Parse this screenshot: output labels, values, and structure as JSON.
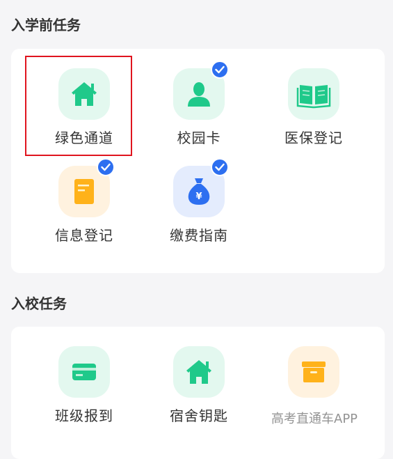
{
  "sections": [
    {
      "title": "入学前任务",
      "items": [
        {
          "label": "绿色通道",
          "icon": "house-icon",
          "checked": false
        },
        {
          "label": "校园卡",
          "icon": "person-icon",
          "checked": true
        },
        {
          "label": "医保登记",
          "icon": "book-icon",
          "checked": false
        },
        {
          "label": "信息登记",
          "icon": "document-icon",
          "checked": true
        },
        {
          "label": "缴费指南",
          "icon": "money-bag-icon",
          "checked": true
        }
      ]
    },
    {
      "title": "入校任务",
      "items": [
        {
          "label": "班级报到",
          "icon": "card-icon",
          "checked": false
        },
        {
          "label": "宿舍钥匙",
          "icon": "house-icon",
          "checked": false
        },
        {
          "label": "",
          "icon": "archive-box-icon",
          "checked": false
        }
      ]
    }
  ],
  "watermark": "高考直通车APP",
  "colors": {
    "accent": "#2d6ff0",
    "icon_green": "#1fc98a",
    "icon_orange": "#ffb21a",
    "highlight": "#e0141e"
  }
}
